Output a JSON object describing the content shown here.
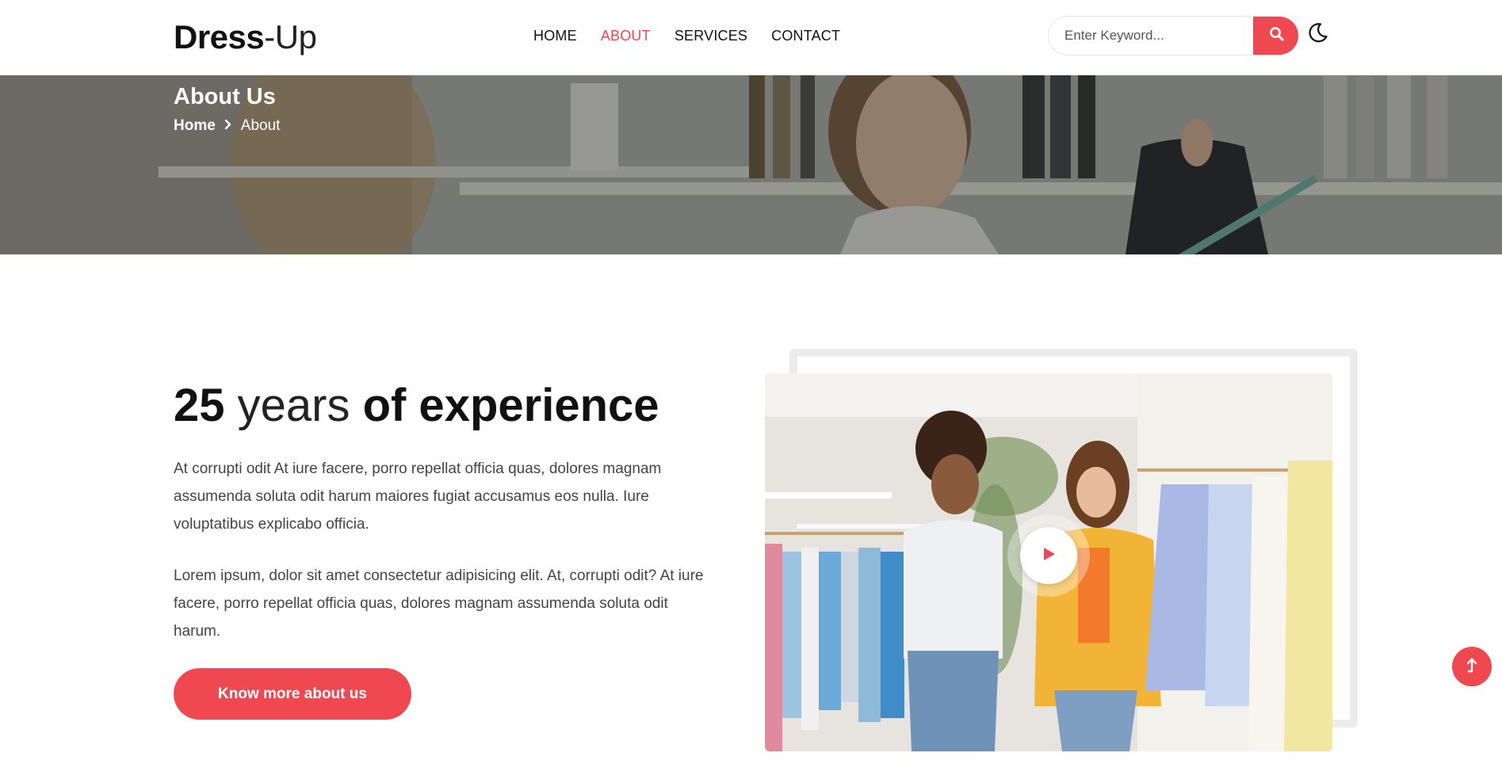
{
  "brand": {
    "name_bold": "Dress",
    "name_light": "-Up"
  },
  "nav": {
    "items": [
      {
        "label": "HOME",
        "active": false
      },
      {
        "label": "ABOUT",
        "active": true
      },
      {
        "label": "SERVICES",
        "active": false
      },
      {
        "label": "CONTACT",
        "active": false
      }
    ]
  },
  "search": {
    "placeholder": "Enter Keyword...",
    "value": "",
    "button_icon": "search-icon"
  },
  "theme_toggle": {
    "icon": "moon-icon"
  },
  "hero": {
    "title": "About Us",
    "breadcrumb": {
      "home": "Home",
      "separator_icon": "chevron-right-icon",
      "current": "About"
    }
  },
  "about": {
    "headline_number": "25",
    "headline_mid": " years ",
    "headline_end": "of experience",
    "paragraph1": "At corrupti odit At iure facere, porro repellat officia quas, dolores magnam assumenda soluta odit harum maiores fugiat accusamus eos nulla. Iure voluptatibus explicabo officia.",
    "paragraph2": "Lorem ipsum, dolor sit amet consectetur adipisicing elit. At, corrupti odit? At iure facere, porro repellat officia quas, dolores magnam assumenda soluta odit harum.",
    "cta_label": "Know more about us"
  },
  "media": {
    "play_icon": "play-icon"
  },
  "back_to_top": {
    "icon": "arrow-up-icon"
  },
  "colors": {
    "accent": "#f04850",
    "text": "#111111",
    "muted": "#444444",
    "frame": "#ececec"
  }
}
